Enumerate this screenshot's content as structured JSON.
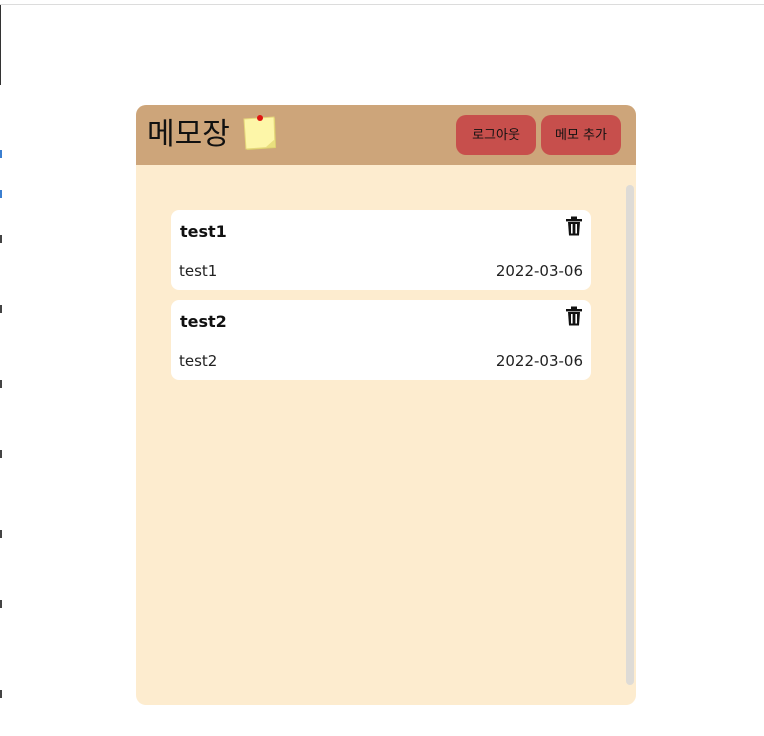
{
  "header": {
    "title": "메모장",
    "logout_label": "로그아웃",
    "add_memo_label": "메모 추가"
  },
  "memos": [
    {
      "title": "test1",
      "content": "test1",
      "date": "2022-03-06"
    },
    {
      "title": "test2",
      "content": "test2",
      "date": "2022-03-06"
    }
  ],
  "colors": {
    "header_bg": "#cda57a",
    "panel_bg": "#fdeccf",
    "button_bg": "#c74f4c",
    "card_bg": "#ffffff"
  },
  "icons": {
    "memo": "sticky-note-icon",
    "delete": "trash-icon"
  }
}
